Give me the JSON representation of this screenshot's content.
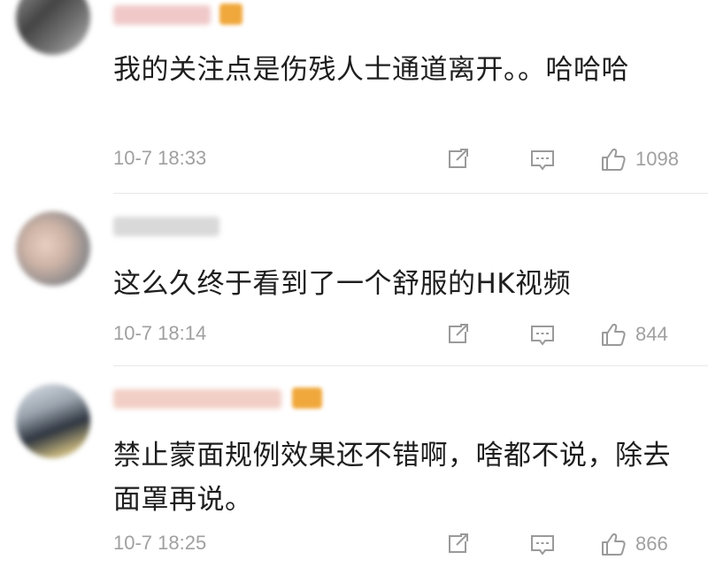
{
  "comments": [
    {
      "text": "我的关注点是伤残人士通道离开。。哈哈哈",
      "timestamp": "10-7 18:33",
      "likes": "1098"
    },
    {
      "text": "这么久终于看到了一个舒服的HK视频",
      "timestamp": "10-7 18:14",
      "likes": "844"
    },
    {
      "text": "禁止蒙面规例效果还不错啊，啥都不说，除去面罩再说。",
      "timestamp": "10-7 18:25",
      "likes": "866"
    }
  ],
  "icons": {
    "share": "share-icon",
    "comment": "comment-icon",
    "like": "thumbs-up-icon"
  },
  "colors": {
    "text": "#1e1e1e",
    "meta": "#a0a0a0",
    "divider": "#e8e8e8",
    "icon": "#9a9a9a"
  }
}
